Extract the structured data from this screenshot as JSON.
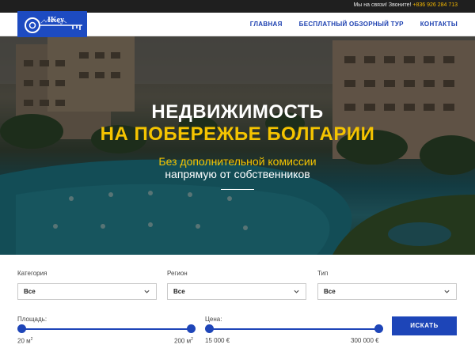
{
  "topbar": {
    "contact_text": "Мы на связи! Звоните!",
    "phone": "+836 926 284 713"
  },
  "logo": {
    "text": "IKey"
  },
  "nav": {
    "items": [
      "ГЛАВНАЯ",
      "БЕСПЛАТНЫЙ ОБЗОРНЫЙ ТУР",
      "КОНТАКТЫ"
    ]
  },
  "hero": {
    "title_line1": "НЕДВИЖИМОСТЬ",
    "title_line2": "НА ПОБЕРЕЖЬЕ БОЛГАРИИ",
    "subtitle_line1": "Без дополнительной комиссии",
    "subtitle_line2": "напрямую от собственников"
  },
  "search": {
    "category": {
      "label": "Категория",
      "value": "Все"
    },
    "region": {
      "label": "Регион",
      "value": "Все"
    },
    "type": {
      "label": "Тип",
      "value": "Все"
    },
    "area": {
      "label": "Площадь:",
      "min": "20 м",
      "max": "200 м",
      "unit_sup": "2"
    },
    "price": {
      "label": "Цена:",
      "min": "15 000 €",
      "max": "300 000 €"
    },
    "submit_label": "ИСКАТЬ"
  },
  "colors": {
    "brand_blue": "#1d45b8",
    "accent_yellow": "#f5c400",
    "topbar_bg": "#1f1f1f"
  }
}
